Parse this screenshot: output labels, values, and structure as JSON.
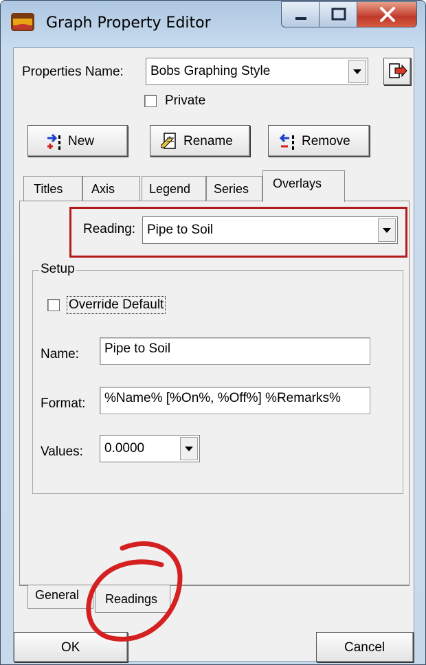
{
  "window": {
    "title": "Graph Property Editor"
  },
  "properties": {
    "name_label": "Properties Name:",
    "name_value": "Bobs Graphing Style",
    "private_label": "Private"
  },
  "toolbar": {
    "new_label": "New",
    "rename_label": "Rename",
    "remove_label": "Remove"
  },
  "tabs": [
    {
      "label": "Titles"
    },
    {
      "label": "Axis"
    },
    {
      "label": "Legend"
    },
    {
      "label": "Series"
    },
    {
      "label": "Overlays",
      "selected": true
    }
  ],
  "overlays": {
    "reading_label": "Reading:",
    "reading_value": "Pipe to Soil",
    "setup": {
      "group_label": "Setup",
      "override_label": "Override Default",
      "name_label": "Name:",
      "name_value": "Pipe to Soil",
      "format_label": "Format:",
      "format_value": "%Name% [%On%, %Off%] %Remarks%",
      "values_label": "Values:",
      "values_value": "0.0000"
    }
  },
  "bottom_tabs": [
    {
      "label": "General"
    },
    {
      "label": "Readings",
      "selected": true
    }
  ],
  "footer": {
    "ok_label": "OK",
    "cancel_label": "Cancel"
  },
  "colors": {
    "highlight": "#b31b1b",
    "annotation": "#d42020"
  }
}
